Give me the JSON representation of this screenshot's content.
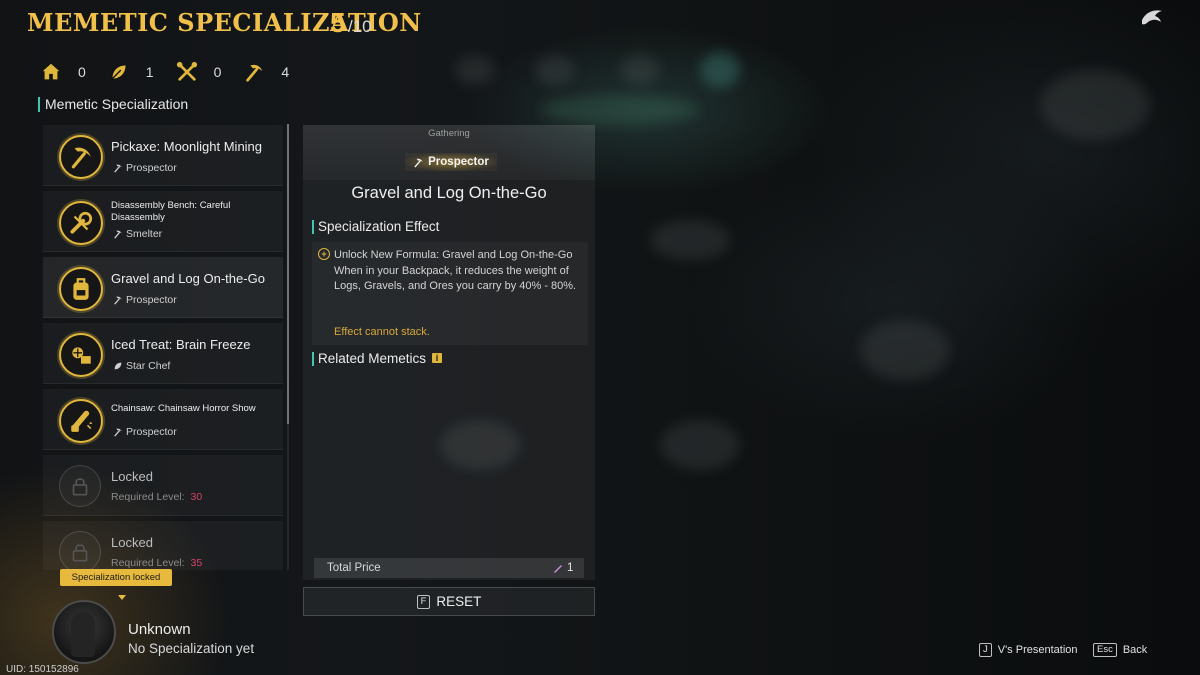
{
  "header": {
    "title": "MEMETIC SPECIALIZATION",
    "count": "5",
    "count_total": "/10",
    "logo_icon": "dolphin-logo-icon"
  },
  "stats": [
    {
      "icon": "house-icon",
      "value": "0"
    },
    {
      "icon": "leaf-icon",
      "value": "1"
    },
    {
      "icon": "tools-icon",
      "value": "0"
    },
    {
      "icon": "pickaxe-icon",
      "value": "4"
    }
  ],
  "sidebar": {
    "section_title": "Memetic Specialization",
    "items": [
      {
        "name": "Pickaxe: Moonlight Mining",
        "sub": "Prospector",
        "sub_icon": "pickaxe-icon",
        "icon": "pickaxe-icon"
      },
      {
        "name": "Disassembly Bench: Careful Disassembly",
        "sub": "Smelter",
        "sub_icon": "pickaxe-icon",
        "icon": "wrench-icon"
      },
      {
        "name": "Gravel and Log On-the-Go",
        "sub": "Prospector",
        "sub_icon": "pickaxe-icon",
        "icon": "backpack-icon"
      },
      {
        "name": "Iced Treat: Brain Freeze",
        "sub": "Star Chef",
        "sub_icon": "leaf-icon",
        "icon": "ice-icon"
      },
      {
        "name": "Chainsaw: Chainsaw Horror Show",
        "sub": "Prospector",
        "sub_icon": "pickaxe-icon",
        "icon": "chainsaw-icon"
      },
      {
        "name": "Locked",
        "req_label": "Required Level:",
        "req_value": "30",
        "icon": "lock-icon"
      },
      {
        "name": "Locked",
        "req_label": "Required Level:",
        "req_value": "35",
        "icon": "lock-icon"
      }
    ]
  },
  "profile": {
    "tooltip": "Specialization locked",
    "name": "Unknown",
    "spec": "No Specialization yet",
    "uid": "UID: 150152896"
  },
  "detail": {
    "category": "Gathering",
    "badge": "Prospector",
    "title": "Gravel and Log On-the-Go",
    "effect_heading": "Specialization Effect",
    "effect_text": "Unlock New Formula: Gravel and Log On-the-Go When in your Backpack, it reduces the weight of Logs, Gravels, and Ores you carry by 40% - 80%.",
    "effect_note": "Effect cannot stack.",
    "related_heading": "Related Memetics",
    "price_label": "Total Price",
    "price_value": "1",
    "reset_key": "F",
    "reset_label": "RESET"
  },
  "footer": {
    "presentation_key": "J",
    "presentation_label": "V's Presentation",
    "back_key": "Esc",
    "back_label": "Back"
  },
  "colors": {
    "accent_gold": "#f1c04a",
    "accent_teal": "#42c6b0",
    "locked_level": "#d6436b"
  }
}
